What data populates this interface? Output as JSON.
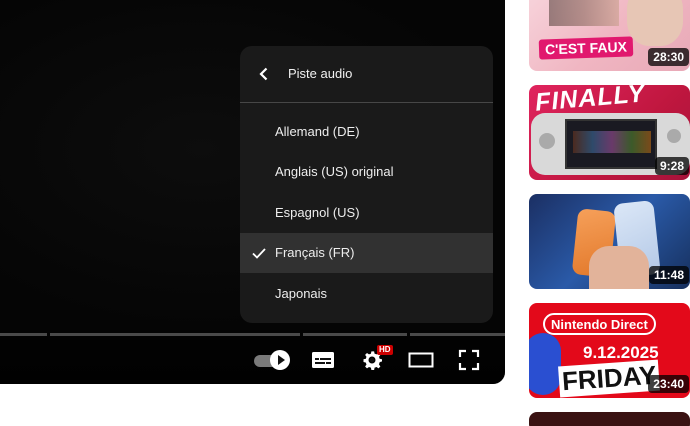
{
  "player": {
    "menu": {
      "title": "Piste audio",
      "items": [
        {
          "label": "Allemand (DE)",
          "selected": false
        },
        {
          "label": "Anglais (US) original",
          "selected": false
        },
        {
          "label": "Espagnol (US)",
          "selected": false
        },
        {
          "label": "Français (FR)",
          "selected": true
        },
        {
          "label": "Japonais",
          "selected": false
        }
      ]
    },
    "controls": {
      "settings_badge": "HD"
    }
  },
  "sidebar": {
    "videos": [
      {
        "thumb_text": "C'EST FAUX",
        "duration": "28:30"
      },
      {
        "thumb_text": "FINALLY",
        "duration": "9:28"
      },
      {
        "thumb_text": "",
        "duration": "11:48"
      },
      {
        "thumb_text": "Nintendo Direct",
        "thumb_text_2": "9.12.2025",
        "thumb_text_3": "FRIDAY",
        "duration": "23:40"
      },
      {
        "thumb_text": "",
        "duration": ""
      }
    ]
  },
  "colors": {
    "accent_red": "#cc0000",
    "menu_bg": "#1c1c1c"
  }
}
